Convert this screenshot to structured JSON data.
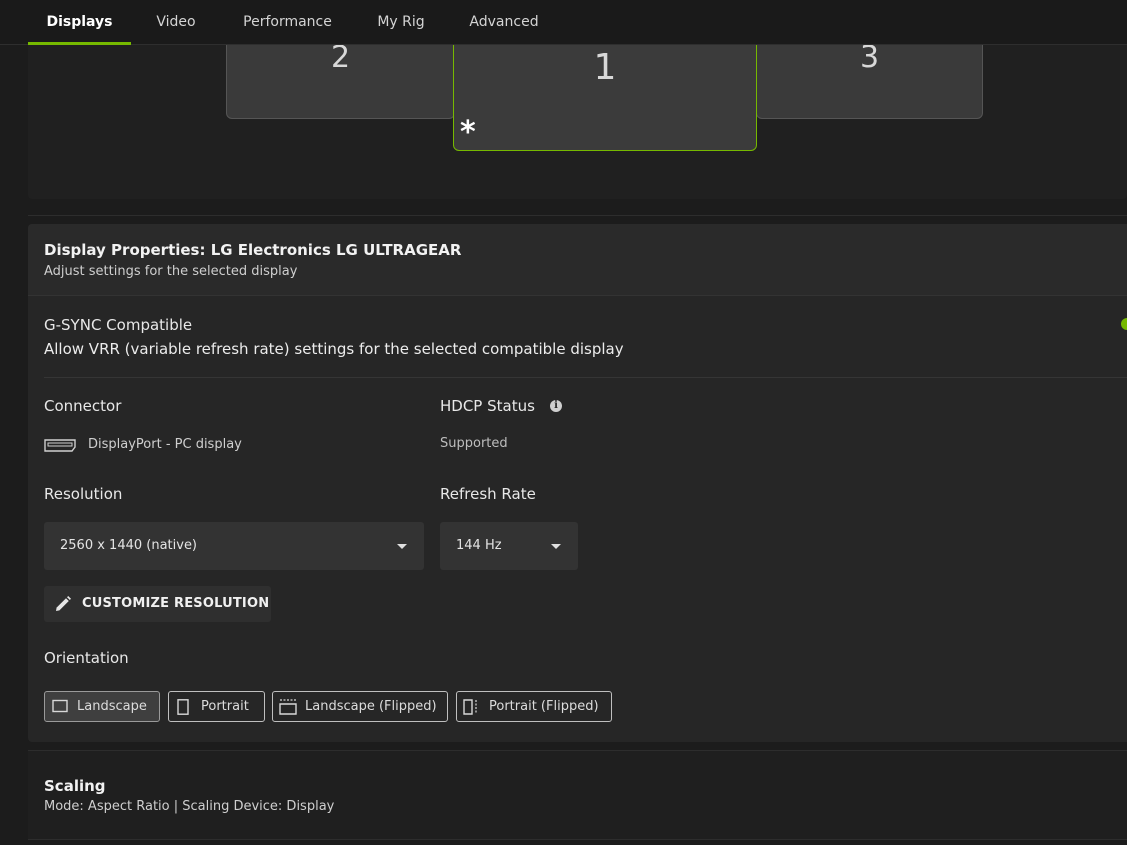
{
  "tabs": [
    {
      "label": "Displays",
      "active": true
    },
    {
      "label": "Video",
      "active": false
    },
    {
      "label": "Performance",
      "active": false
    },
    {
      "label": "My Rig",
      "active": false
    },
    {
      "label": "Advanced",
      "active": false
    }
  ],
  "arrangement": {
    "monitors": [
      {
        "number": "2"
      },
      {
        "number": "1",
        "primary_mark": "*"
      },
      {
        "number": "3"
      }
    ]
  },
  "properties": {
    "title": "Display Properties: LG Electronics LG ULTRAGEAR",
    "subtitle": "Adjust settings for the selected display",
    "gsync": {
      "label": "G-SYNC Compatible",
      "description": "Allow VRR (variable refresh rate) settings for the selected compatible display",
      "enabled": true
    },
    "connector": {
      "label": "Connector",
      "value": "DisplayPort - PC display"
    },
    "hdcp": {
      "label": "HDCP Status",
      "value": "Supported"
    },
    "resolution": {
      "label": "Resolution",
      "value": "2560 x 1440 (native)"
    },
    "refresh_rate": {
      "label": "Refresh Rate",
      "value": "144 Hz"
    },
    "customize_label": "CUSTOMIZE RESOLUTION",
    "orientation": {
      "label": "Orientation",
      "options": [
        {
          "label": "Landscape",
          "selected": true
        },
        {
          "label": "Portrait",
          "selected": false
        },
        {
          "label": "Landscape (Flipped)",
          "selected": false
        },
        {
          "label": "Portrait (Flipped)",
          "selected": false
        }
      ]
    }
  },
  "scaling": {
    "title": "Scaling",
    "subtitle": "Mode: Aspect Ratio | Scaling Device: Display"
  },
  "colors": {
    "accent": "#76b900",
    "background": "#1c1c1c",
    "panel": "#262626"
  }
}
